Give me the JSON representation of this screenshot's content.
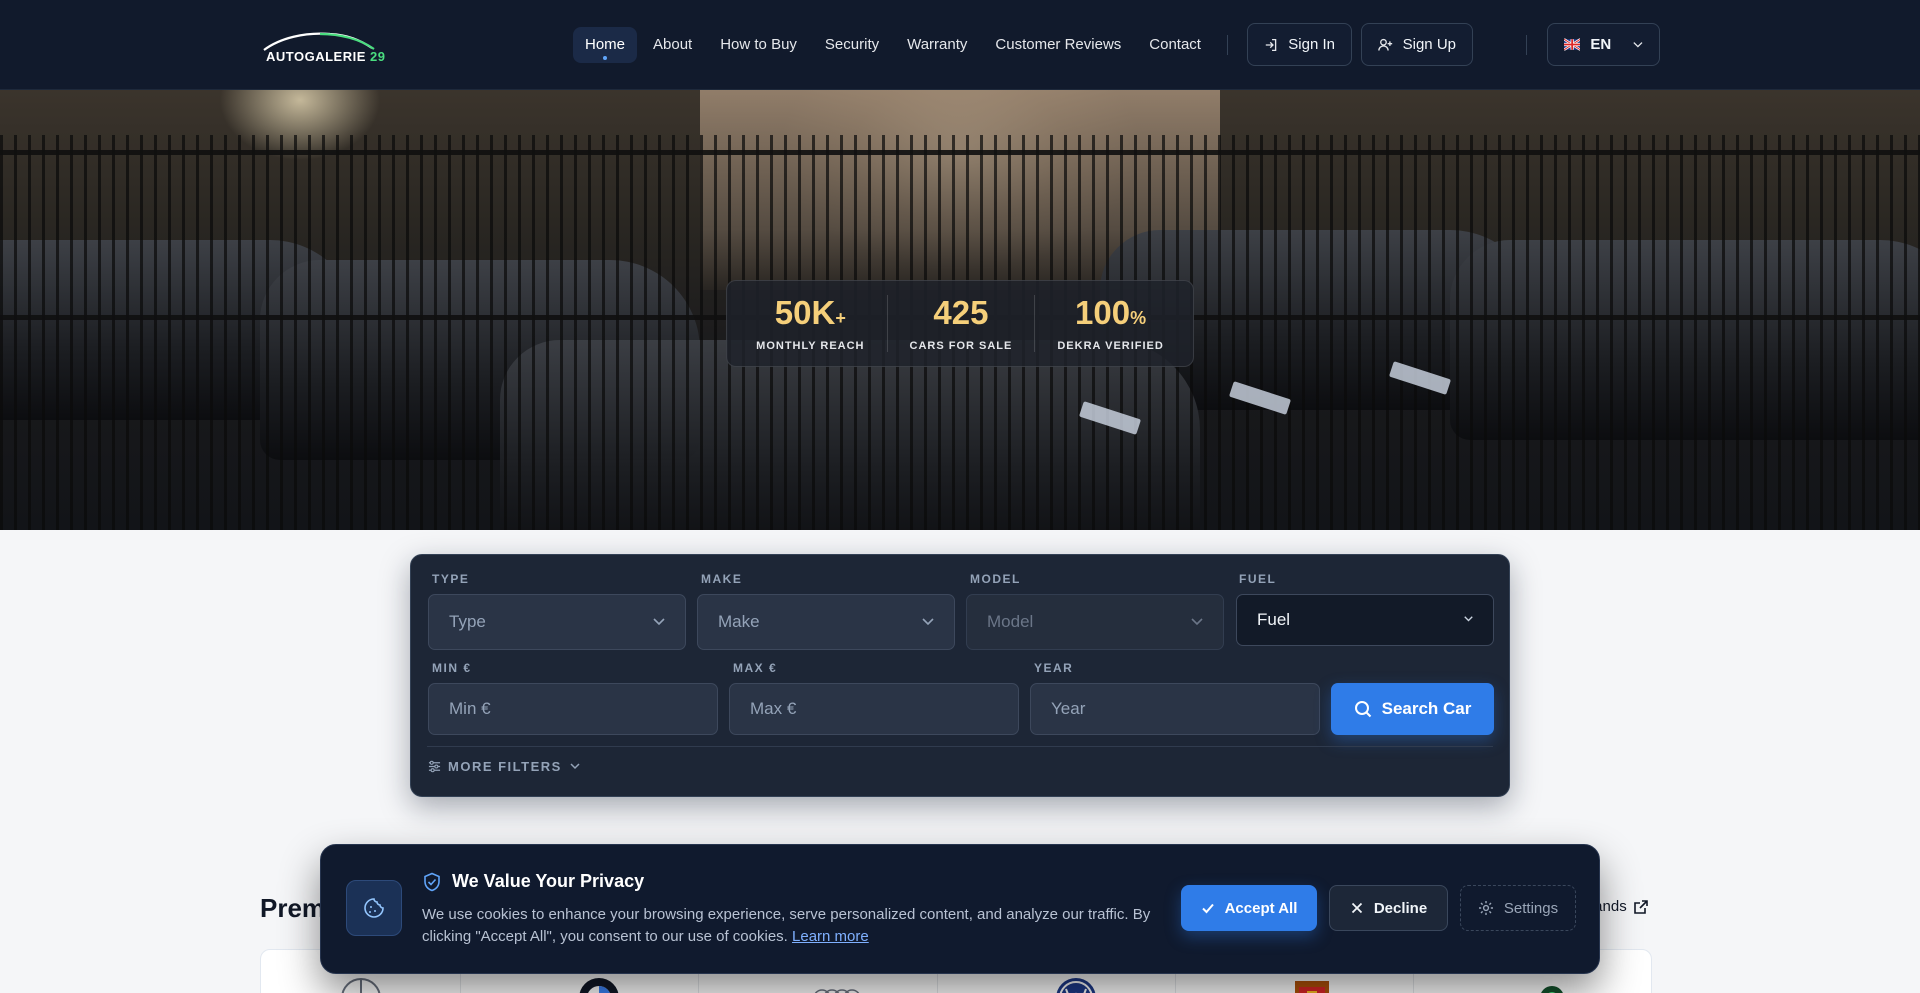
{
  "header": {
    "logo_text": "AUTOGALERIE",
    "logo_number": "29",
    "nav": [
      {
        "label": "Home",
        "active": true
      },
      {
        "label": "About"
      },
      {
        "label": "How to Buy"
      },
      {
        "label": "Security"
      },
      {
        "label": "Warranty"
      },
      {
        "label": "Customer Reviews"
      },
      {
        "label": "Contact"
      }
    ],
    "sign_in": "Sign In",
    "sign_up": "Sign Up",
    "language": "EN"
  },
  "hero": {
    "stats": [
      {
        "value": "50K",
        "suffix": "+",
        "label": "MONTHLY REACH"
      },
      {
        "value": "425",
        "suffix": "",
        "label": "CARS FOR SALE"
      },
      {
        "value": "100",
        "suffix": "%",
        "label": "DEKRA VERIFIED"
      }
    ]
  },
  "search": {
    "type": {
      "label": "TYPE",
      "value": "Type"
    },
    "make": {
      "label": "MAKE",
      "value": "Make"
    },
    "model": {
      "label": "MODEL",
      "value": "Model"
    },
    "fuel": {
      "label": "FUEL",
      "value": "Fuel"
    },
    "min": {
      "label": "MIN €",
      "placeholder": "Min €"
    },
    "max": {
      "label": "MAX €",
      "placeholder": "Max €"
    },
    "year": {
      "label": "YEAR",
      "placeholder": "Year"
    },
    "search_button": "Search Car",
    "more_filters": "MORE FILTERS"
  },
  "brands": {
    "title": "Premium Brands",
    "link": "All brands"
  },
  "cookie": {
    "title": "We Value Your Privacy",
    "text": "We use cookies to enhance your browsing experience, serve personalized content, and analyze our traffic. By clicking \"Accept All\", you consent to our use of cookies.",
    "learn_more": "Learn more",
    "accept": "Accept All",
    "decline": "Decline",
    "settings": "Settings"
  },
  "colors": {
    "header_bg": "#111a2c",
    "accent": "#2f7ce8",
    "stat_gold": "#f5cf7a",
    "logo_green": "#4ade80"
  }
}
